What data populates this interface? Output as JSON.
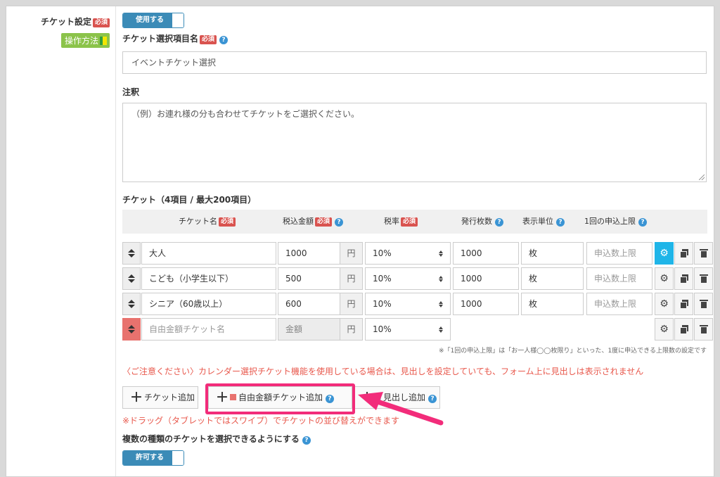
{
  "left": {
    "ticket_setting": "チケット設定",
    "required": "必須",
    "howto": "操作方法"
  },
  "use_toggle": {
    "label": "使用する"
  },
  "select_title": {
    "label": "チケット選択項目名",
    "required": "必須",
    "help": "?",
    "value": "イベントチケット選択"
  },
  "annotation": {
    "label": "注釈",
    "value": "（例）お連れ様の分も合わせてチケットをご選択ください。"
  },
  "tickets": {
    "heading": "チケット（4項目 / 最大200項目）",
    "headers": {
      "name": "チケット名",
      "price": "税込金額",
      "tax": "税率",
      "count": "発行枚数",
      "unit": "表示単位",
      "limit": "1回の申込上限",
      "required": "必須",
      "help": "?"
    },
    "currency": "円",
    "gear": "⚙",
    "rows": [
      {
        "name": "大人",
        "price": "1000",
        "tax": "10%",
        "count": "1000",
        "unit": "枚",
        "limit": "申込数上限"
      },
      {
        "name": "こども（小学生以下）",
        "price": "500",
        "tax": "10%",
        "count": "1000",
        "unit": "枚",
        "limit": "申込数上限"
      },
      {
        "name": "シニア（60歳以上）",
        "price": "600",
        "tax": "10%",
        "count": "1000",
        "unit": "枚",
        "limit": "申込数上限"
      },
      {
        "name": "自由金額チケット名",
        "price": "金額",
        "tax": "10%"
      }
    ]
  },
  "notes": {
    "small": "※「1回の申込上限」は「お一人様◯◯枚限り」といった、1度に申込できる上限数の設定です",
    "warning": "〈ご注意ください〉カレンダー選択チケット機能を使用している場合は、見出しを設定していても、フォーム上に見出しは表示されません",
    "drag": "※ドラッグ（タブレットではスワイプ）でチケットの並び替えができます"
  },
  "buttons": {
    "plus": "＋",
    "add_ticket": "チケット追加",
    "add_free": "自由金額チケット追加",
    "add_heading": "見出し追加",
    "help": "?"
  },
  "multi": {
    "label": "複数の種類のチケットを選択できるようにする",
    "help": "?",
    "toggle": "許可する"
  },
  "colors": {
    "accent": "#3b8bb7",
    "required": "#d9534f",
    "highlight": "#f22c7a",
    "warning": "#e8584c",
    "active": "#1fb5e8"
  }
}
